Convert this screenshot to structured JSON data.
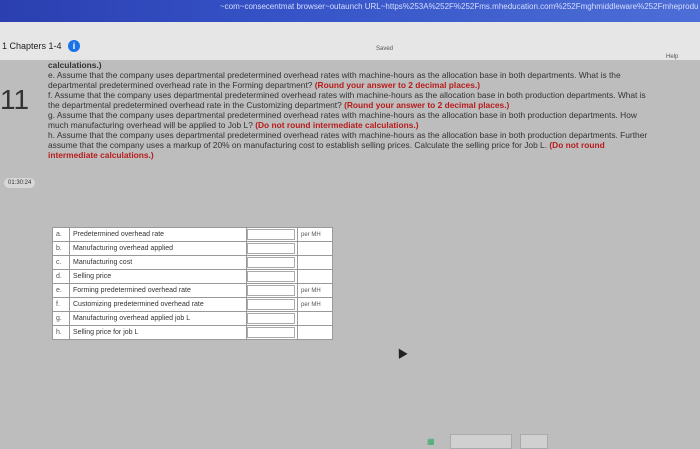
{
  "browser": {
    "url": "~com~consecentmat browser~outaunch URL~https%253A%252F%252Fms.mheducation.com%252Fmghmiddleware%252Fmheprodu"
  },
  "header": {
    "chapter_title": "1 Chapters 1-4",
    "info_icon": "i",
    "saved_label": "Saved",
    "help_label": "Help"
  },
  "question": {
    "number": "11",
    "timer": "01:30:24"
  },
  "instructions": {
    "calc_line": "calculations.)",
    "e_text": "e. Assume that the company uses departmental predetermined overhead rates with machine-hours as the allocation base in both departments. What is the departmental predetermined overhead rate in the Forming department?",
    "e_note": "(Round your answer to 2 decimal places.)",
    "f_text": "f. Assume that the company uses departmental predetermined overhead rates with machine-hours as the allocation base in both production departments. What is the departmental predetermined overhead rate in the Customizing department?",
    "f_note": "(Round your answer to 2 decimal places.)",
    "g_text": "g. Assume that the company uses departmental predetermined overhead rates with machine-hours as the allocation base in both production departments. How much manufacturing overhead will be applied to Job L?",
    "g_note": "(Do not round intermediate calculations.)",
    "h_text": "h. Assume that the company uses departmental predetermined overhead rates with machine-hours as the allocation base in both production departments. Further assume that the company uses a markup of 20% on manufacturing cost to establish selling prices. Calculate the selling price for Job L.",
    "h_note": "(Do not round intermediate calculations.)"
  },
  "answer_table": {
    "rows": [
      {
        "letter": "a.",
        "label": "Predetermined overhead rate",
        "value": "",
        "unit": "per MH"
      },
      {
        "letter": "b.",
        "label": "Manufacturing overhead applied",
        "value": "",
        "unit": ""
      },
      {
        "letter": "c.",
        "label": "Manufacturing cost",
        "value": "",
        "unit": ""
      },
      {
        "letter": "d.",
        "label": "Selling price",
        "value": "",
        "unit": ""
      },
      {
        "letter": "e.",
        "label": "Forming predetermined overhead rate",
        "value": "",
        "unit": "per MH"
      },
      {
        "letter": "f.",
        "label": "Customizing predetermined overhead rate",
        "value": "",
        "unit": "per MH"
      },
      {
        "letter": "g.",
        "label": "Manufacturing overhead applied job L",
        "value": "",
        "unit": ""
      },
      {
        "letter": "h.",
        "label": "Selling price for job L",
        "value": "",
        "unit": ""
      }
    ]
  }
}
